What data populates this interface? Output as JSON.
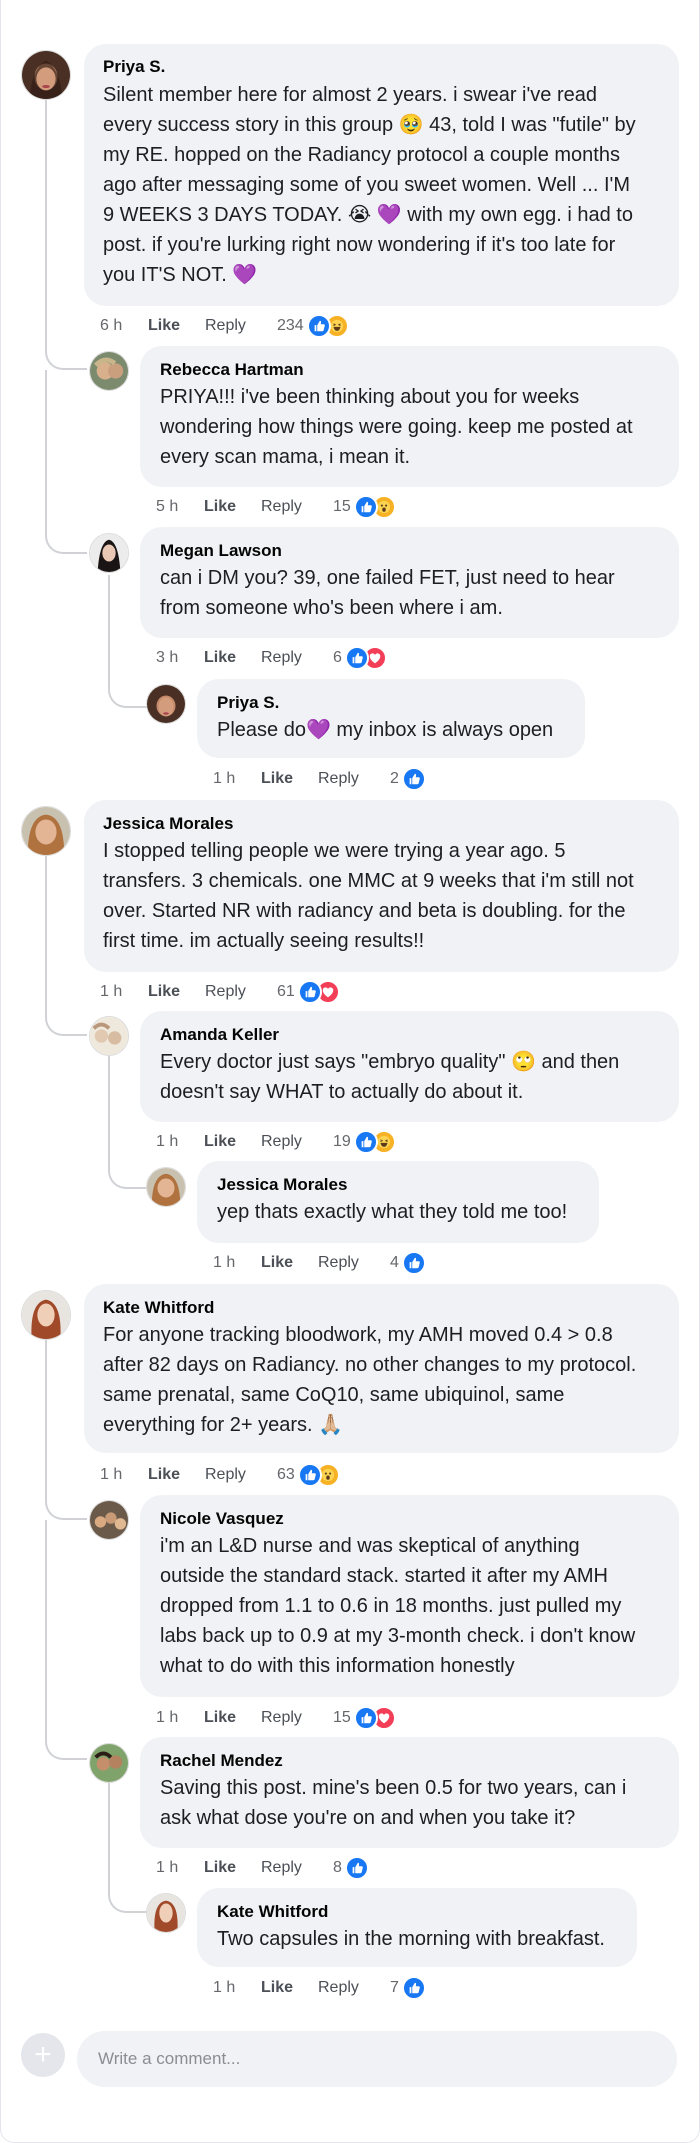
{
  "comments": [
    {
      "author": "Priya S.",
      "text": "Silent member here for almost 2 years. i swear i've read\nevery success story in this group 🥹  43, told I was \"futile\" by\nmy RE. hopped on the Radiancy protocol a couple months\nago after messaging some of you sweet women. Well ... I'M\n9 WEEKS 3 DAYS TODAY. 😭 💜  with my own egg. i had to\npost. if you're lurking right now wondering if it's too late for\nyou IT'S NOT. 💜",
      "time": "6 h",
      "like": "Like",
      "reply": "Reply",
      "count": "234",
      "reactions": [
        "like",
        "haha"
      ]
    },
    {
      "author": "Rebecca Hartman",
      "text": "PRIYA!!! i've been thinking about you for weeks\nwondering how things were going. keep me posted at\nevery scan mama, i mean it.",
      "time": "5 h",
      "like": "Like",
      "reply": "Reply",
      "count": "15",
      "reactions": [
        "like",
        "wow"
      ]
    },
    {
      "author": "Megan Lawson",
      "text": "can i DM you? 39, one failed FET, just need to hear\nfrom someone who's been where i am.",
      "time": "3 h",
      "like": "Like",
      "reply": "Reply",
      "count": "6",
      "reactions": [
        "like",
        "love"
      ]
    },
    {
      "author": "Priya S.",
      "text": "Please do💜  my inbox is always open",
      "time": "1 h",
      "like": "Like",
      "reply": "Reply",
      "count": "2",
      "reactions": [
        "like"
      ]
    },
    {
      "author": "Jessica Morales",
      "text": "I stopped telling people we were trying a year ago. 5\ntransfers. 3 chemicals. one MMC at 9 weeks that i'm still not\nover. Started NR with radiancy and beta is doubling. for the\nfirst time. im actually seeing results!!",
      "time": "1 h",
      "like": "Like",
      "reply": "Reply",
      "count": "61",
      "reactions": [
        "like",
        "love"
      ]
    },
    {
      "author": "Amanda Keller",
      "text": "Every doctor just says \"embryo quality\" 🙄  and then\ndoesn't say WHAT to actually do about it.",
      "time": "1 h",
      "like": "Like",
      "reply": "Reply",
      "count": "19",
      "reactions": [
        "like",
        "haha"
      ]
    },
    {
      "author": "Jessica Morales",
      "text": "yep thats exactly what they told me too!",
      "time": "1 h",
      "like": "Like",
      "reply": "Reply",
      "count": "4",
      "reactions": [
        "like"
      ]
    },
    {
      "author": "Kate Whitford",
      "text": "For anyone tracking bloodwork, my AMH moved 0.4 > 0.8\nafter 82 days on Radiancy. no other changes to my protocol.\nsame prenatal, same CoQ10, same ubiquinol, same\neverything for 2+ years. 🙏🏼",
      "time": "1 h",
      "like": "Like",
      "reply": "Reply",
      "count": "63",
      "reactions": [
        "like",
        "wow"
      ]
    },
    {
      "author": "Nicole Vasquez",
      "text": "i'm an L&D nurse and was skeptical of anything\noutside the standard stack. started it after my AMH\ndropped from 1.1 to 0.6 in 18 months. just pulled my\nlabs back up to 0.9 at my 3-month check. i don't know\nwhat to do with this information honestly",
      "time": "1 h",
      "like": "Like",
      "reply": "Reply",
      "count": "15",
      "reactions": [
        "like",
        "love"
      ]
    },
    {
      "author": "Rachel Mendez",
      "text": "Saving this post. mine's been 0.5 for two years, can i\nask what dose you're on and when you take it?",
      "time": "1 h",
      "like": "Like",
      "reply": "Reply",
      "count": "8",
      "reactions": [
        "like"
      ]
    },
    {
      "author": "Kate Whitford",
      "text": "Two capsules in the morning with breakfast.",
      "time": "1 h",
      "like": "Like",
      "reply": "Reply",
      "count": "7",
      "reactions": [
        "like"
      ]
    }
  ],
  "composer": {
    "placeholder": "Write a comment..."
  },
  "colors": {
    "bubble": "#f0f2f5",
    "like": "#1877f2",
    "love": "#f33e58",
    "haha_wow": "#f7b125",
    "thread_line": "#d0d2d6"
  },
  "icons": {
    "add": "plus-icon",
    "like": "thumbs-up-icon",
    "love": "heart-icon",
    "haha": "laughing-face-icon",
    "wow": "surprised-face-icon"
  }
}
